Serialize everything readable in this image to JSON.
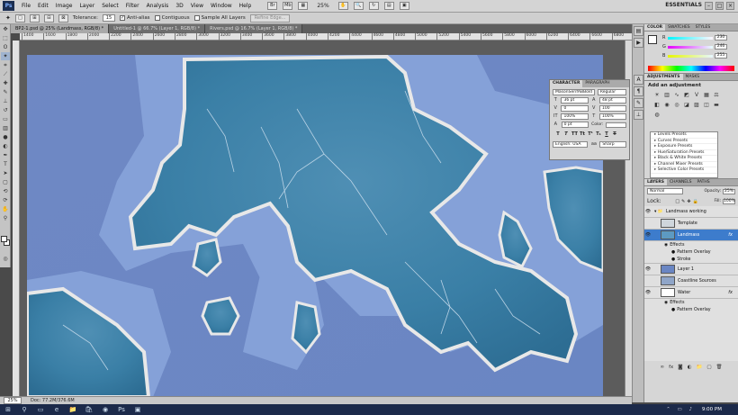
{
  "app": {
    "logo": "Ps",
    "menu": [
      "File",
      "Edit",
      "Image",
      "Layer",
      "Select",
      "Filter",
      "Analysis",
      "3D",
      "View",
      "Window",
      "Help"
    ],
    "zoom": "25%",
    "workspace": "ESSENTIALS"
  },
  "options": {
    "tolerance_label": "Tolerance:",
    "tolerance_value": "15",
    "anti_alias": "Anti-alias",
    "contiguous": "Contiguous",
    "sample_all": "Sample All Layers",
    "refine_edge": "Refine Edge..."
  },
  "tabs": [
    {
      "label": "BP2-1.psd @ 25% (Landmass, RGB/8) *",
      "active": true
    },
    {
      "label": "Untitled-1 @ 66.7% (Layer 1, RGB/8) *",
      "active": false
    },
    {
      "label": "Rivers.psd @ 16.7% (Layer 1, RGB/8) *",
      "active": false
    }
  ],
  "ruler_marks": [
    "1400",
    "1600",
    "1800",
    "2000",
    "2200",
    "2400",
    "2600",
    "2800",
    "3000",
    "3200",
    "3400",
    "3600",
    "3800",
    "4000",
    "4200",
    "4400",
    "4600",
    "4800",
    "5000",
    "5200",
    "5400",
    "5600",
    "5800",
    "6000",
    "6200",
    "6400",
    "6600",
    "6800"
  ],
  "status": {
    "zoom": "25%",
    "doc": "Doc: 77.2M/376.6M"
  },
  "character": {
    "tabs": [
      "CHARACTER",
      "PARAGRAPH"
    ],
    "font": "MasonSerifABBold",
    "style": "Regular",
    "size": "36 pt",
    "leading": "48 pt",
    "kerning": "0",
    "tracking": "100",
    "vscale": "100%",
    "hscale": "100%",
    "baseline": "0 pt",
    "color_label": "Color:",
    "styles": [
      "T",
      "T",
      "TT",
      "Tt",
      "T¹",
      "T₁",
      "T",
      "T"
    ],
    "language": "English: USA",
    "aa_icon": "aa",
    "antialias": "Sharp"
  },
  "color_panel": {
    "tabs": [
      "COLOR",
      "SWATCHES",
      "STYLES"
    ],
    "r": "230",
    "g": "246",
    "b": "255",
    "accent": "#e6f6ff"
  },
  "adjustments": {
    "tabs": [
      "ADJUSTMENTS",
      "MASKS"
    ],
    "title": "Add an adjustment",
    "presets": [
      "Levels Presets",
      "Curves Presets",
      "Exposure Presets",
      "Hue/Saturation Presets",
      "Black & White Presets",
      "Channel Mixer Presets",
      "Selective Color Presets"
    ]
  },
  "layers": {
    "tabs": [
      "LAYERS",
      "CHANNELS",
      "PATHS"
    ],
    "blend_mode": "Normal",
    "opacity_label": "Opacity:",
    "opacity": "25%",
    "lock_label": "Lock:",
    "fill_label": "Fill:",
    "fill": "100%",
    "rows": [
      {
        "name": "Landmass working",
        "kind": "group"
      },
      {
        "name": "Template",
        "kind": "layer"
      },
      {
        "name": "Landmass",
        "kind": "layer",
        "selected": true,
        "fx": "fx"
      },
      {
        "name": "Effects",
        "kind": "sub"
      },
      {
        "name": "Pattern Overlay",
        "kind": "sub2"
      },
      {
        "name": "Stroke",
        "kind": "sub2"
      },
      {
        "name": "Layer 1",
        "kind": "layer"
      },
      {
        "name": "Coastline Sources",
        "kind": "group"
      },
      {
        "name": "Water",
        "kind": "layer",
        "fx": "fx"
      },
      {
        "name": "Effects",
        "kind": "sub"
      },
      {
        "name": "Pattern Overlay",
        "kind": "sub2"
      }
    ]
  },
  "taskbar": {
    "time": "9:00 PM"
  }
}
